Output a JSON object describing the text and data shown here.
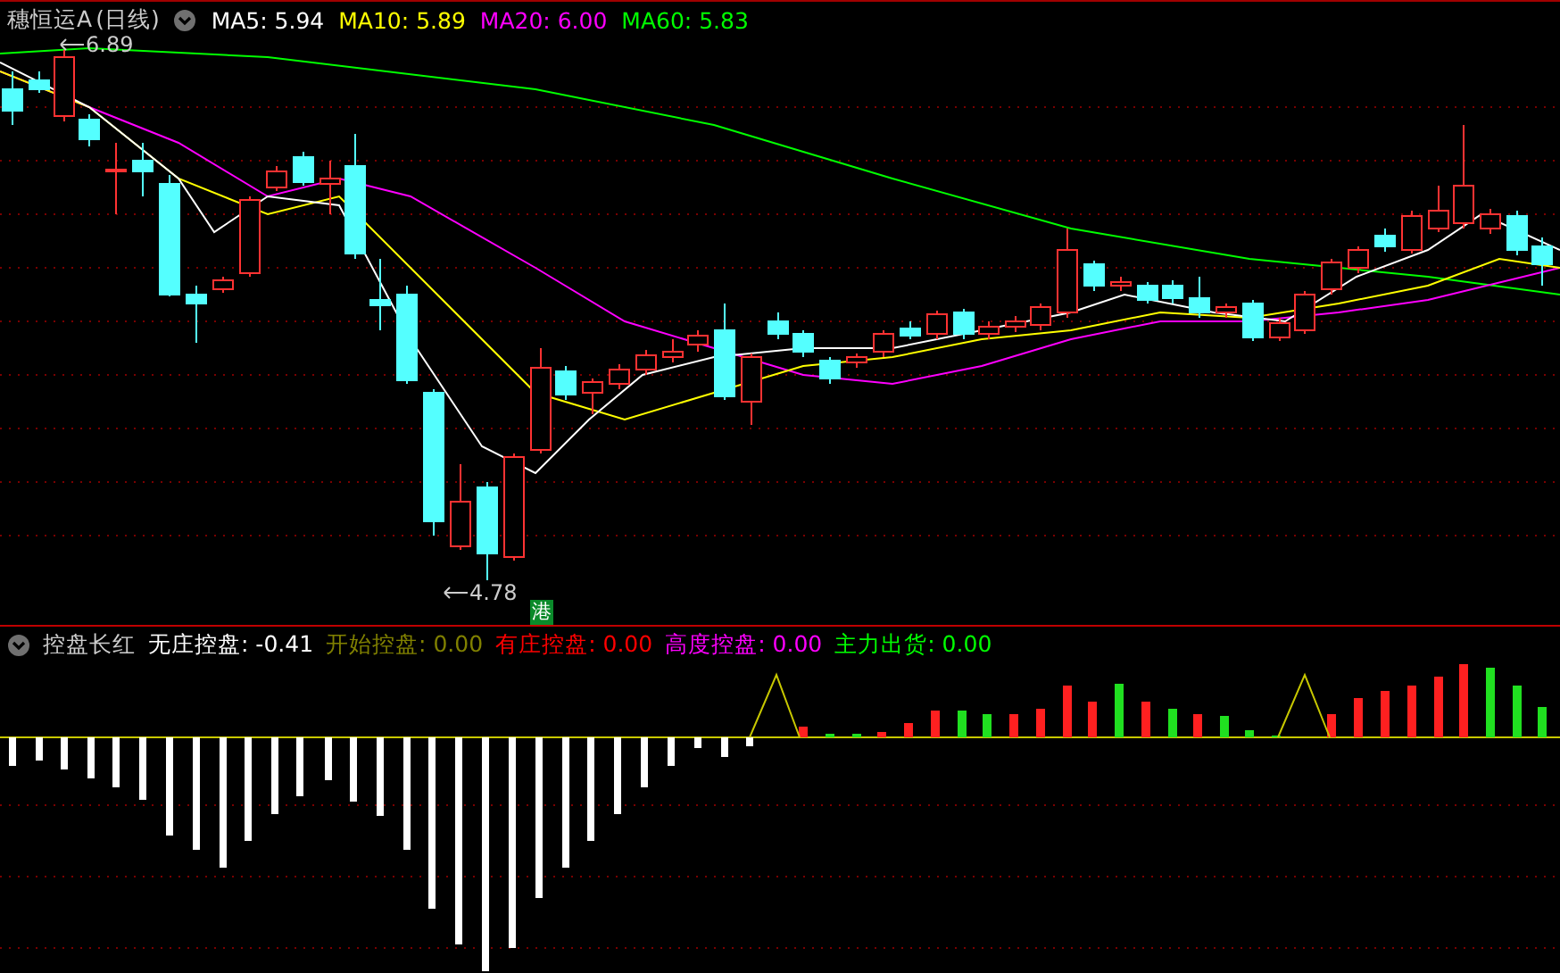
{
  "title": {
    "name": "穗恒运A",
    "period": "(日线)"
  },
  "ma_legend": [
    {
      "label": "MA5: 5.94",
      "color": "#ffffff"
    },
    {
      "label": "MA10: 5.89",
      "color": "#ffff00"
    },
    {
      "label": "MA20: 6.00",
      "color": "#ff00ff"
    },
    {
      "label": "MA60: 5.83",
      "color": "#00ff00"
    }
  ],
  "price_labels": [
    {
      "kind": "high",
      "text": "6.89"
    },
    {
      "kind": "low",
      "text": "4.78"
    }
  ],
  "badge": "港",
  "indicator": {
    "name": "控盘长红",
    "legend": [
      {
        "label": "无庄控盘: -0.41",
        "color": "#ffffff"
      },
      {
        "label": "开始控盘: 0.00",
        "color": "#808000"
      },
      {
        "label": "有庄控盘: 0.00",
        "color": "#ff0000"
      },
      {
        "label": "高度控盘: 0.00",
        "color": "#ff00ff"
      },
      {
        "label": "主力出货: 0.00",
        "color": "#00ff00"
      }
    ]
  }
}
